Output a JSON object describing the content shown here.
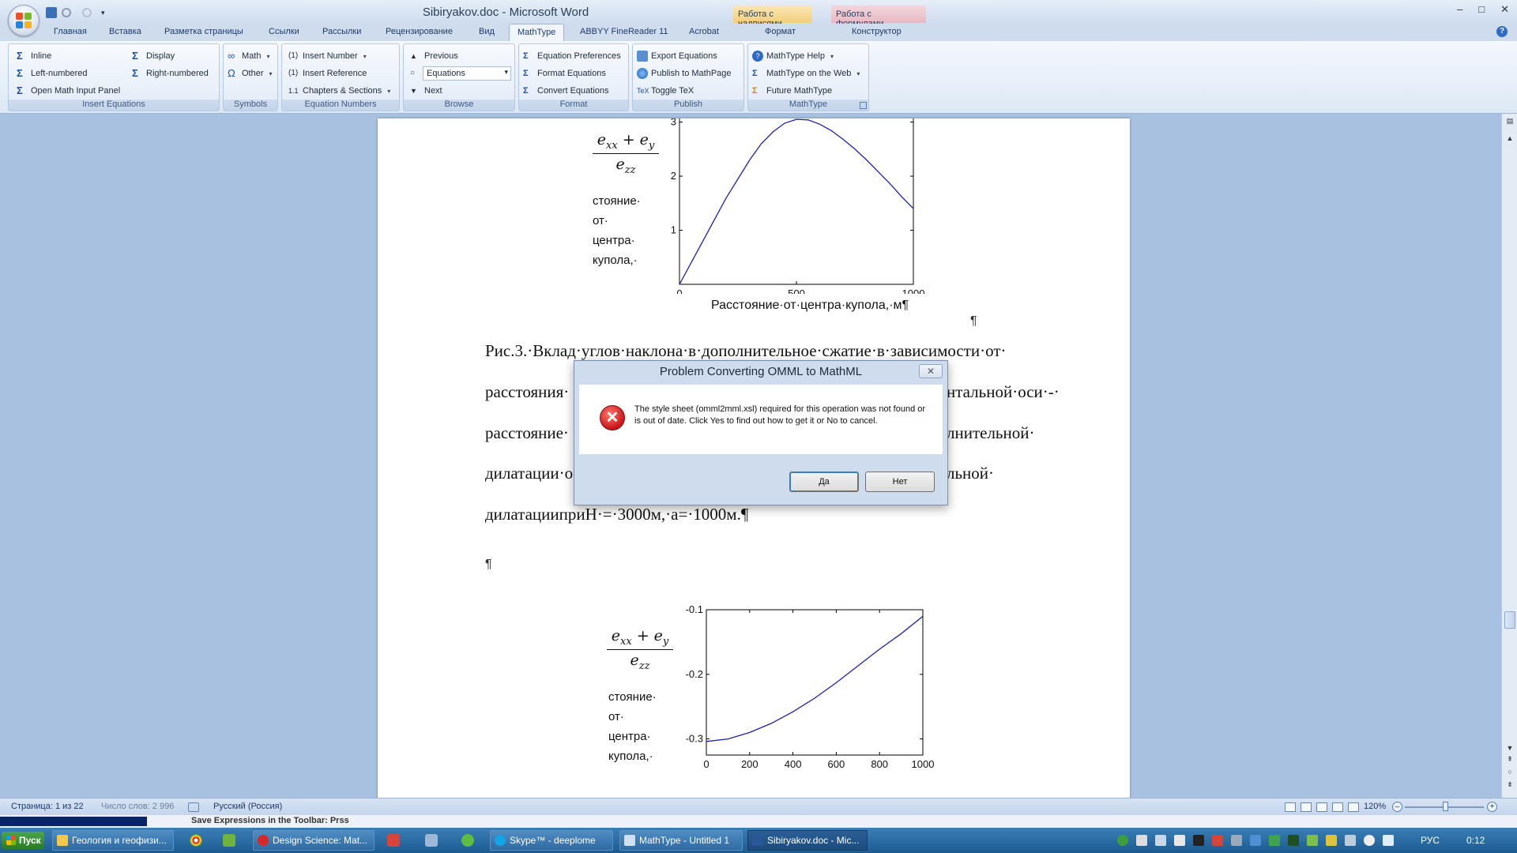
{
  "window": {
    "title": "Sibiryakov.doc - Microsoft Word",
    "context_tabs": [
      "Работа с надписями",
      "Работа с формулами"
    ],
    "controls": {
      "minimize": "–",
      "maximize": "□",
      "close": "✕"
    }
  },
  "tabs": [
    {
      "label": "Главная"
    },
    {
      "label": "Вставка"
    },
    {
      "label": "Разметка страницы"
    },
    {
      "label": "Ссылки"
    },
    {
      "label": "Рассылки"
    },
    {
      "label": "Рецензирование"
    },
    {
      "label": "Вид"
    },
    {
      "label": "MathType"
    },
    {
      "label": "ABBYY FineReader 11"
    },
    {
      "label": "Acrobat"
    },
    {
      "label": "Формат"
    },
    {
      "label": "Конструктор"
    }
  ],
  "active_tab": "MathType",
  "ribbon": {
    "insert_equations": {
      "label": "Insert Equations",
      "inline": "Inline",
      "left_numbered": "Left-numbered",
      "open_panel": "Open Math Input Panel",
      "display": "Display",
      "right_numbered": "Right-numbered"
    },
    "symbols": {
      "label": "Symbols",
      "math": "Math",
      "other": "Other"
    },
    "equation_numbers": {
      "label": "Equation Numbers",
      "insert_number": "Insert Number",
      "insert_reference": "Insert Reference",
      "chapters_sections": "Chapters & Sections"
    },
    "browse": {
      "label": "Browse",
      "previous": "Previous",
      "combo_value": "Equations",
      "next": "Next"
    },
    "format": {
      "label": "Format",
      "preferences": "Equation Preferences",
      "format_equations": "Format Equations",
      "convert": "Convert Equations"
    },
    "publish": {
      "label": "Publish",
      "export": "Export Equations",
      "mathpage": "Publish to MathPage",
      "toggle_tex": "Toggle TeX"
    },
    "mathtype": {
      "label": "MathType",
      "help": "MathType Help",
      "web": "MathType on the Web",
      "future": "Future MathType"
    }
  },
  "document": {
    "chart1": {
      "ylabel_num": "e",
      "ylabel_num_sub1": "xx",
      "ylabel_plus": " + ",
      "ylabel_num_sub2": "y",
      "ylabel_den_sub": "zz",
      "ylabel_words": [
        "стояние·",
        "от·",
        "центра·",
        "купола,·"
      ],
      "xlabel": "Расстояние·от·центра·купола,·м¶"
    },
    "pilcrow_right": "¶",
    "caption_lines": [
      "Рис.3.·Вклад·углов·наклона·в·дополнительное·сжатие·в·зависимости·от·",
      "расстояния·",
      "расстояние·",
      "дилатации·о",
      "дилатацииприН·=·3000м,·a=·1000м.¶"
    ],
    "caption_right_fragments": [
      "нтальной·оси·-·",
      "лнительной·",
      "льной·"
    ],
    "empty_paragraph": "¶",
    "chart2": {
      "ylabel_words": [
        "стояние·",
        "от·",
        "центра·",
        "купола,·"
      ]
    }
  },
  "chart_data": [
    {
      "type": "line",
      "title": "",
      "xlabel": "Расстояние·от·центра·купола,·м",
      "ylabel": "",
      "xlim": [
        0,
        1000
      ],
      "ylim": [
        0,
        3.3
      ],
      "x_ticks": [
        0,
        500,
        1000
      ],
      "y_ticks": [
        1,
        2,
        3
      ],
      "line_color": "#1f1fb4",
      "series": [
        {
          "x": [
            0,
            50,
            100,
            150,
            200,
            250,
            300,
            350,
            400,
            450,
            500,
            550,
            600,
            650,
            700,
            750,
            800,
            850,
            900,
            950,
            1000
          ],
          "values": [
            0,
            0.4,
            0.8,
            1.2,
            1.6,
            1.95,
            2.3,
            2.6,
            2.82,
            2.98,
            3.05,
            3.04,
            2.96,
            2.84,
            2.68,
            2.5,
            2.3,
            2.08,
            1.86,
            1.62,
            1.4
          ]
        }
      ]
    },
    {
      "type": "line",
      "title": "",
      "xlabel": "",
      "ylabel": "",
      "xlim": [
        0,
        1000
      ],
      "ylim": [
        -0.325,
        -0.1
      ],
      "x_ticks": [
        0,
        200,
        400,
        600,
        800,
        1000
      ],
      "y_ticks": [
        -0.1,
        -0.2,
        -0.3
      ],
      "line_color": "#1f1fb4",
      "series": [
        {
          "x": [
            0,
            100,
            200,
            300,
            400,
            500,
            600,
            700,
            800,
            900,
            1000
          ],
          "values": [
            -0.304,
            -0.3,
            -0.29,
            -0.276,
            -0.258,
            -0.237,
            -0.213,
            -0.187,
            -0.161,
            -0.137,
            -0.11
          ]
        }
      ]
    }
  ],
  "dialog": {
    "title": "Problem Converting OMML to MathML",
    "close": "✕",
    "error_icon": "✕",
    "message": "The style sheet (omml2mml.xsl) required for this operation was not found or is out of date. Click Yes to find out how to get it or No to cancel.",
    "yes": "Да",
    "no": "Нет"
  },
  "statusbar": {
    "page": "Страница: 1 из 22",
    "words": "Число слов: 2 996",
    "language": "Русский (Россия)",
    "zoom": "120%",
    "zoom_out": "–",
    "zoom_in": "+"
  },
  "help_strip": {
    "text": "Save Expressions in the Toolbar: Prss"
  },
  "taskbar": {
    "start": "Пуск",
    "items": [
      {
        "label": "Геология и геофизи..."
      },
      {
        "label": "Design Science: Mat..."
      },
      {
        "label": "Skype™ - deeplome"
      },
      {
        "label": "MathType - Untitled 1"
      },
      {
        "label": "Sibiryakov.doc - Mic..."
      }
    ],
    "lang": "РУС",
    "clock": "0:12"
  }
}
